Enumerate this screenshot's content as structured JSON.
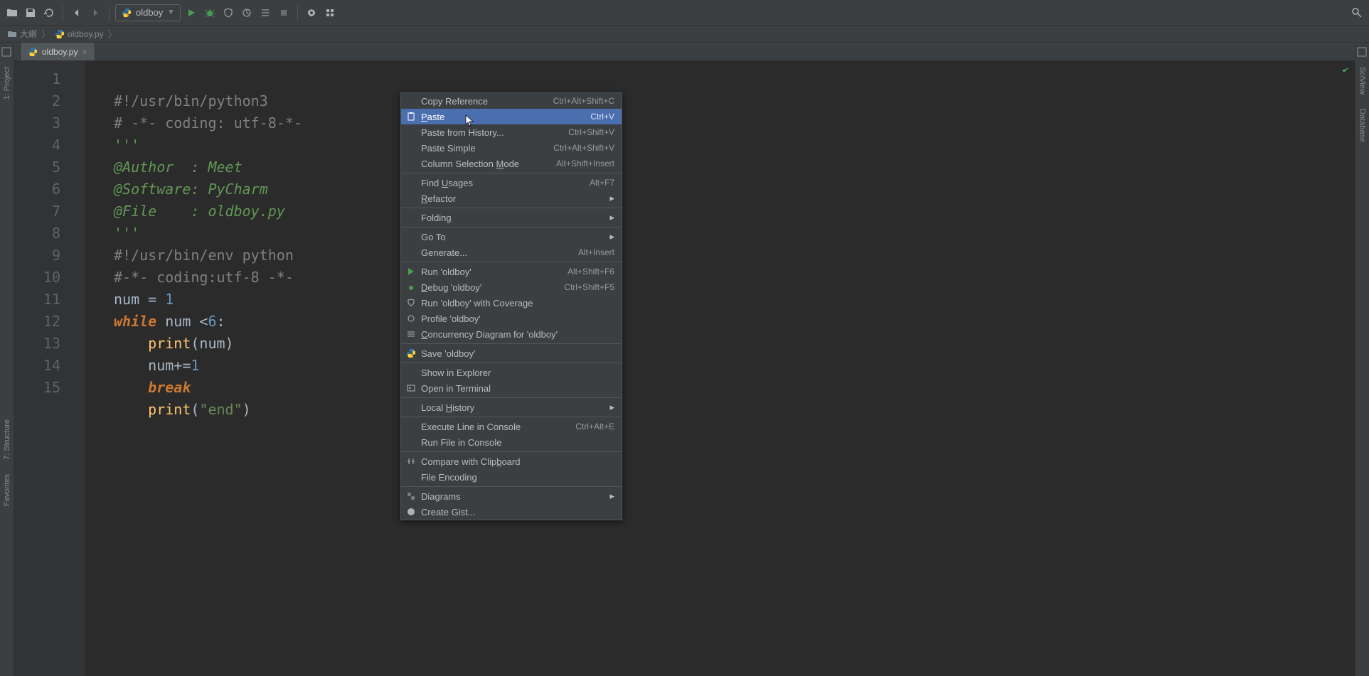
{
  "toolbar": {
    "run_config_label": "oldboy"
  },
  "breadcrumbs": {
    "item1": "大纲",
    "item2": "oldboy.py"
  },
  "left_gutter": {
    "project_label": "1: Project",
    "structure_label": "7: Structure",
    "favorites_label": "Favorites"
  },
  "right_gutter": {
    "sciview_label": "SciView",
    "database_label": "Database"
  },
  "tab": {
    "label": "oldboy.py"
  },
  "code": {
    "lines": [
      "1",
      "2",
      "3",
      "4",
      "5",
      "6",
      "7",
      "8",
      "9",
      "10",
      "11",
      "12",
      "13",
      "14",
      "15"
    ],
    "l1": "#!/usr/bin/python3",
    "l2": "# -*- coding: utf-8-*-",
    "l3": "'''",
    "l4": "@Author  : Meet",
    "l5": "@Software: PyCharm",
    "l6": "@File    : oldboy.py",
    "l7": "'''",
    "l8": "#!/usr/bin/env python",
    "l9": "#-*- coding:utf-8 -*-",
    "l10_a": "num = ",
    "l10_b": "1",
    "l11_a": "while",
    "l11_b": " num <",
    "l11_c": "6",
    "l11_d": ":",
    "l12_a": "    ",
    "l12_b": "print",
    "l12_c": "(num)",
    "l13_a": "    num+=",
    "l13_b": "1",
    "l14_a": "    ",
    "l14_b": "break",
    "l15_a": "    ",
    "l15_b": "print",
    "l15_c": "(",
    "l15_d": "\"end\"",
    "l15_e": ")"
  },
  "context_menu": {
    "copy_reference": "Copy Reference",
    "copy_reference_sc": "Ctrl+Alt+Shift+C",
    "paste": "Paste",
    "paste_sc": "Ctrl+V",
    "paste_history": "Paste from History...",
    "paste_history_sc": "Ctrl+Shift+V",
    "paste_simple": "Paste Simple",
    "paste_simple_sc": "Ctrl+Alt+Shift+V",
    "column_mode": "Column Selection Mode",
    "column_mode_sc": "Alt+Shift+Insert",
    "find_usages": "Find Usages",
    "find_usages_sc": "Alt+F7",
    "refactor": "Refactor",
    "folding": "Folding",
    "goto": "Go To",
    "generate": "Generate...",
    "generate_sc": "Alt+Insert",
    "run": "Run 'oldboy'",
    "run_sc": "Alt+Shift+F6",
    "debug": "Debug 'oldboy'",
    "debug_sc": "Ctrl+Shift+F5",
    "coverage": "Run 'oldboy' with Coverage",
    "profile": "Profile 'oldboy'",
    "concurrency": "Concurrency Diagram for 'oldboy'",
    "save": "Save 'oldboy'",
    "show_explorer": "Show in Explorer",
    "open_terminal": "Open in Terminal",
    "local_history": "Local History",
    "exec_line": "Execute Line in Console",
    "exec_line_sc": "Ctrl+Alt+E",
    "run_file": "Run File in Console",
    "compare_clip": "Compare with Clipboard",
    "file_encoding": "File Encoding",
    "diagrams": "Diagrams",
    "create_gist": "Create Gist..."
  }
}
